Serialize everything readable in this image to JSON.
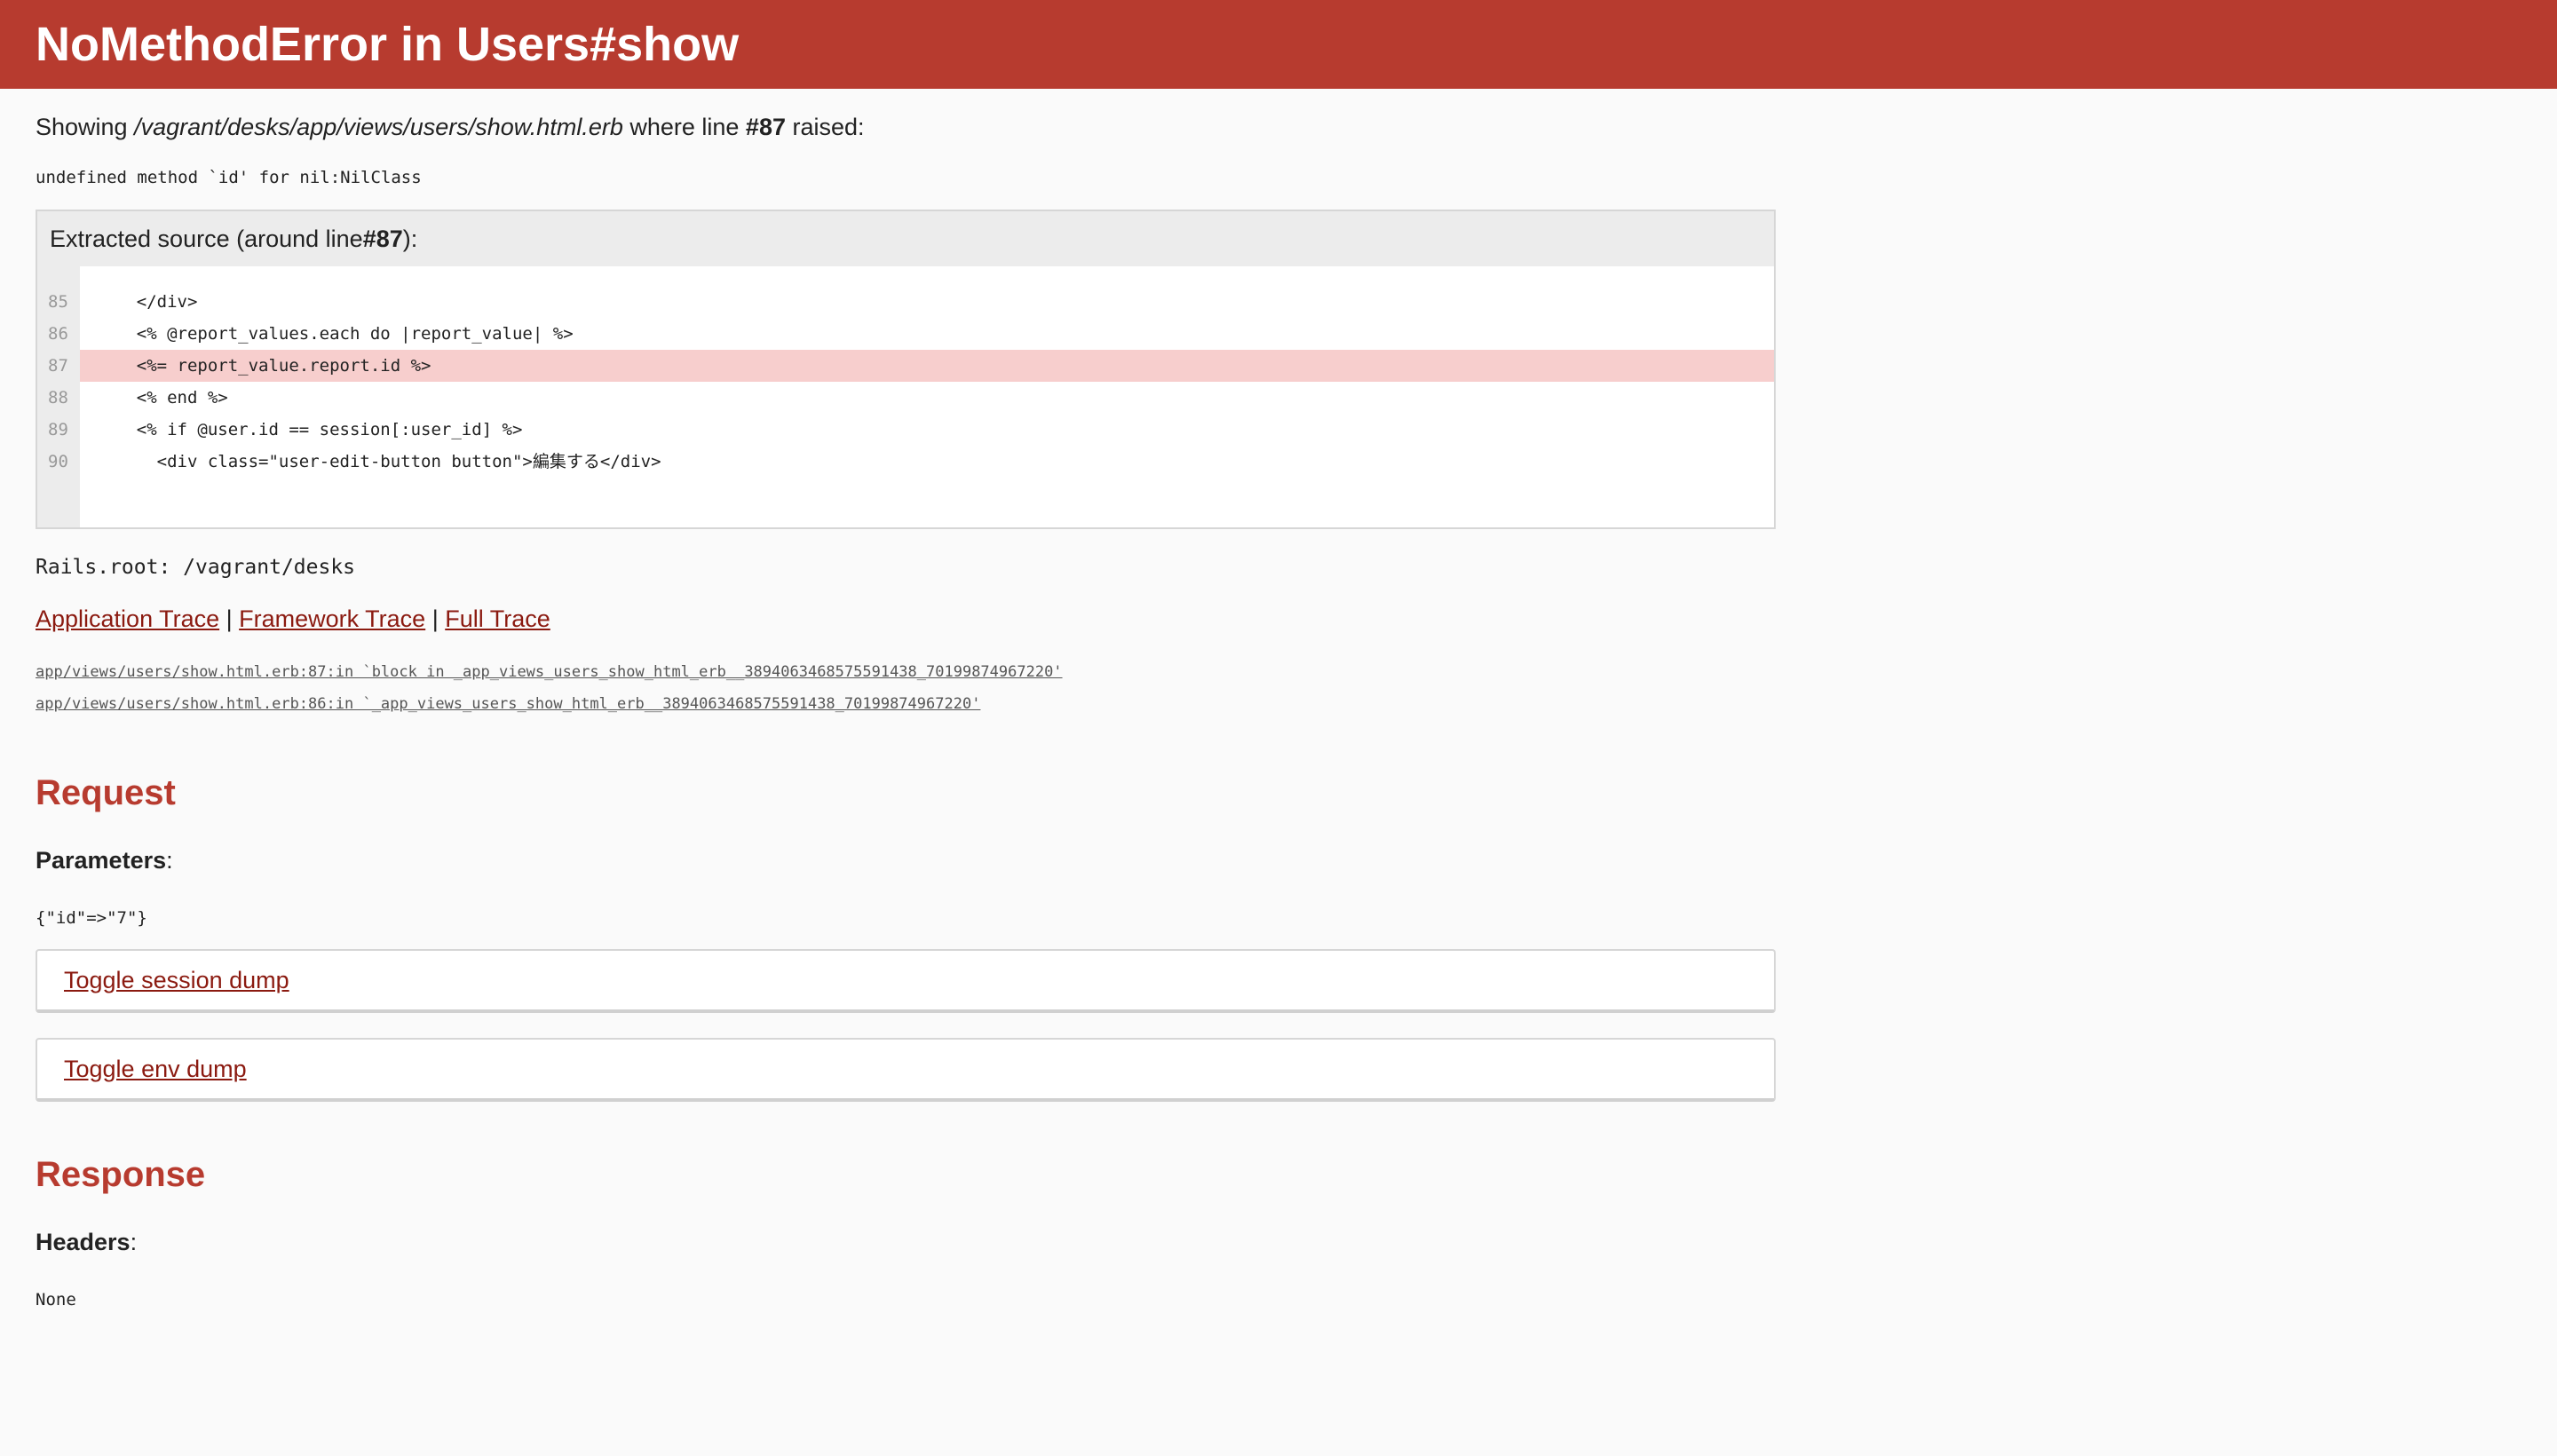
{
  "header": {
    "title": "NoMethodError in Users#show"
  },
  "showing": {
    "prefix": "Showing ",
    "path": "/vagrant/desks/app/views/users/show.html.erb",
    "middle": " where line ",
    "line": "#87",
    "suffix": " raised:"
  },
  "error_message": "undefined method `id' for nil:NilClass",
  "source": {
    "header_prefix": "Extracted source (around line ",
    "header_line": "#87",
    "header_suffix": "):",
    "lines": [
      {
        "num": "85",
        "code": "    </div>"
      },
      {
        "num": "86",
        "code": "    <% @report_values.each do |report_value| %>"
      },
      {
        "num": "87",
        "code": "    <%= report_value.report.id %>"
      },
      {
        "num": "88",
        "code": "    <% end %>"
      },
      {
        "num": "89",
        "code": "    <% if @user.id == session[:user_id] %>"
      },
      {
        "num": "90",
        "code": "      <div class=\"user-edit-button button\">編集する</div>"
      }
    ]
  },
  "rails_root": "Rails.root: /vagrant/desks",
  "trace_links": {
    "application": "Application Trace",
    "sep1": " | ",
    "framework": "Framework Trace",
    "sep2": " | ",
    "full": "Full Trace"
  },
  "traces": [
    "app/views/users/show.html.erb:87:in `block in _app_views_users_show_html_erb__3894063468575591438_70199874967220'",
    "app/views/users/show.html.erb:86:in `_app_views_users_show_html_erb__3894063468575591438_70199874967220'"
  ],
  "request": {
    "title": "Request",
    "params_label": "Parameters",
    "params_colon": ":",
    "params_value": "{\"id\"=>\"7\"}",
    "toggle_session": "Toggle session dump",
    "toggle_env": "Toggle env dump"
  },
  "response": {
    "title": "Response",
    "headers_label": "Headers",
    "headers_colon": ":",
    "headers_value": "None"
  },
  "colors": {
    "header_bg": "#b73b2f",
    "link": "#8b1a10",
    "highlight": "#f7cecd"
  }
}
